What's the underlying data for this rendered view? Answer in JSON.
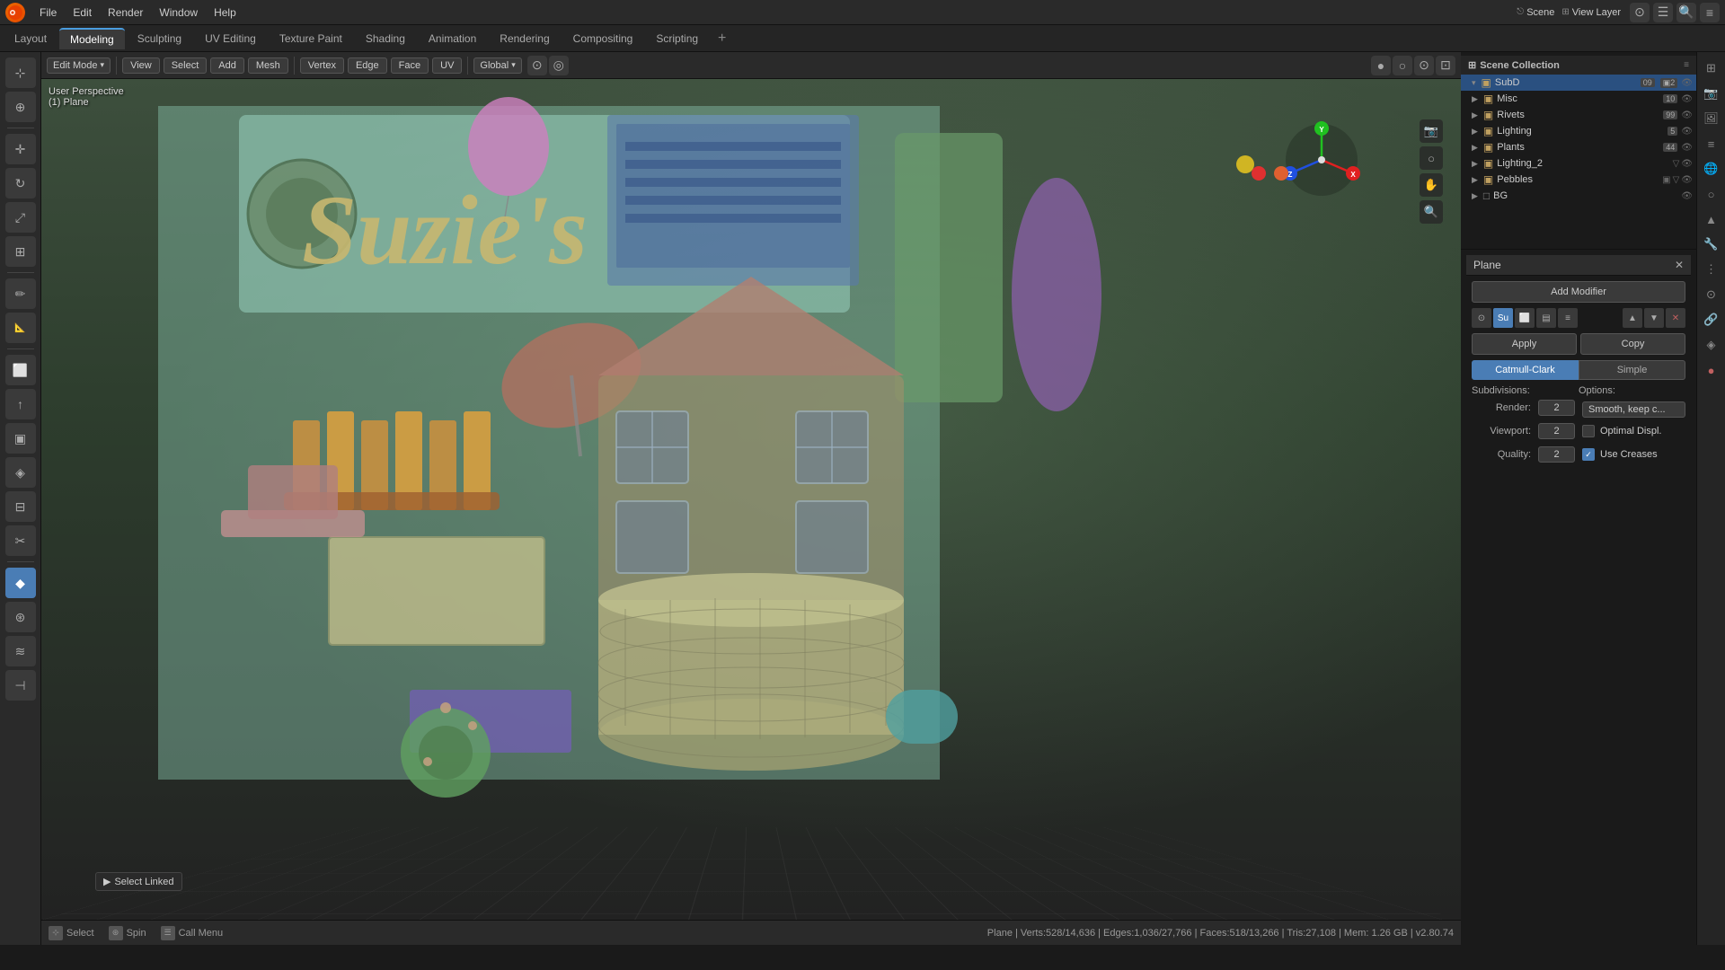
{
  "app": {
    "logo": "B",
    "title": "Blender"
  },
  "top_menu": {
    "items": [
      "File",
      "Edit",
      "Render",
      "Window",
      "Help"
    ]
  },
  "workspace_tabs": {
    "tabs": [
      "Layout",
      "Modeling",
      "Sculpting",
      "UV Editing",
      "Texture Paint",
      "Shading",
      "Animation",
      "Rendering",
      "Compositing",
      "Scripting"
    ],
    "active": "Modeling",
    "add_label": "+"
  },
  "viewport_header": {
    "mode_label": "Edit Mode",
    "view_label": "View",
    "select_label": "Select",
    "add_label": "Add",
    "mesh_label": "Mesh",
    "vertex_label": "Vertex",
    "edge_label": "Edge",
    "face_label": "Face",
    "uv_label": "UV",
    "pivot_label": "Global",
    "snapping_icon": "⊙"
  },
  "viewport_info": {
    "perspective": "User Perspective",
    "object": "(1) Plane"
  },
  "tools": {
    "items": [
      {
        "name": "select-tool",
        "icon": "⊹",
        "active": false
      },
      {
        "name": "cursor-tool",
        "icon": "⊕",
        "active": false
      },
      {
        "name": "move-tool",
        "icon": "✛",
        "active": false
      },
      {
        "name": "rotate-tool",
        "icon": "↻",
        "active": false
      },
      {
        "name": "scale-tool",
        "icon": "⤢",
        "active": false
      },
      {
        "name": "transform-tool",
        "icon": "⊞",
        "active": false
      },
      {
        "name": "annotate-tool",
        "icon": "✏",
        "active": false
      },
      {
        "name": "measure-tool",
        "icon": "📏",
        "active": false
      },
      {
        "name": "add-cube-tool",
        "icon": "⬜",
        "active": false
      },
      {
        "name": "extrude-tool",
        "icon": "↑",
        "active": false
      },
      {
        "name": "inset-tool",
        "icon": "▣",
        "active": false
      },
      {
        "name": "bevel-tool",
        "icon": "◈",
        "active": false
      },
      {
        "name": "loop-cut-tool",
        "icon": "⊟",
        "active": false
      },
      {
        "name": "knife-tool",
        "icon": "✂",
        "active": false
      },
      {
        "name": "poly-build-tool",
        "icon": "◆",
        "active": true
      },
      {
        "name": "spin-tool",
        "icon": "⊛",
        "active": false
      },
      {
        "name": "smooth-tool",
        "icon": "≋",
        "active": false
      },
      {
        "name": "edge-slide-tool",
        "icon": "⊣",
        "active": false
      }
    ]
  },
  "outliner": {
    "title": "Scene Collection",
    "items": [
      {
        "name": "SubD",
        "icon": "▣",
        "level": 1,
        "expanded": true,
        "badge": "09",
        "badge2": "2",
        "selected": true
      },
      {
        "name": "Misc",
        "icon": "▣",
        "level": 1,
        "expanded": false,
        "badge": "10"
      },
      {
        "name": "Rivets",
        "icon": "▣",
        "level": 1,
        "expanded": false,
        "badge": "99"
      },
      {
        "name": "Lighting",
        "icon": "▣",
        "level": 1,
        "expanded": false,
        "badge": "5"
      },
      {
        "name": "Plants",
        "icon": "▣",
        "level": 1,
        "expanded": false,
        "badge": "44"
      },
      {
        "name": "Lighting_2",
        "icon": "▣",
        "level": 1,
        "expanded": false
      },
      {
        "name": "Pebbles",
        "icon": "▣",
        "level": 1,
        "expanded": false
      },
      {
        "name": "BG",
        "icon": "▣",
        "level": 1,
        "expanded": false
      }
    ]
  },
  "properties": {
    "object_name": "Plane",
    "close_icon": "✕",
    "add_modifier_label": "Add Modifier",
    "modifier": {
      "name": "SubD",
      "apply_label": "Apply",
      "copy_label": "Copy",
      "type_catmull": "Catmull-Clark",
      "type_simple": "Simple",
      "active_type": "Catmull-Clark",
      "subdivisions_label": "Subdivisions:",
      "options_label": "Options:",
      "render_label": "Render:",
      "render_value": "2",
      "viewport_label": "Viewport:",
      "viewport_value": "2",
      "quality_label": "Quality:",
      "quality_value": "2",
      "smooth_label": "Smooth, keep c...",
      "optimal_label": "Optimal Displ.",
      "use_creases_label": "Use Creases",
      "smooth_checked": false,
      "optimal_checked": false,
      "creases_checked": true
    }
  },
  "status_bar": {
    "text": "Plane | Verts:528/14,636 | Edges:1,036/27,766 | Faces:518/13,266 | Tris:27,108 | Mem: 1.26 GB | v2.80.74"
  },
  "bottom_bar": {
    "select_label": "Select",
    "spin_label": "Spin",
    "call_menu_label": "Call Menu",
    "select_linked_label": "Select Linked"
  },
  "colors": {
    "accent": "#4a7db5",
    "active_tab_border": "#4a9de0",
    "bg_dark": "#1a1a1a",
    "bg_panel": "#2a2a2a",
    "header_bg": "#252525"
  }
}
